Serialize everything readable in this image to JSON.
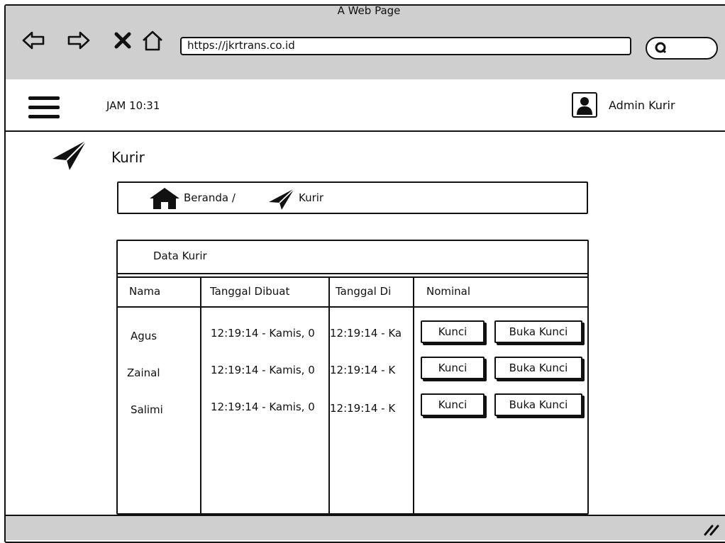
{
  "browser": {
    "title": "A Web Page",
    "url": "https://jkrtrans.co.id"
  },
  "header": {
    "time": "JAM 10:31",
    "user": "Admin Kurir"
  },
  "page": {
    "title": "Kurir",
    "breadcrumb": [
      "Beranda /",
      "Kurir"
    ]
  },
  "panel": {
    "title": "Data Kurir",
    "columns": [
      "Nama",
      "Tanggal Dibuat",
      "Tanggal Di",
      "Nominal"
    ],
    "rows": [
      {
        "nama": "Agus",
        "dibuat": "12:19:14 - Kamis, 0",
        "di": "12:19:14 - Ka"
      },
      {
        "nama": "Zainal",
        "dibuat": "12:19:14 - Kamis, 0",
        "di": "12:19:14 - K"
      },
      {
        "nama": "Salimi",
        "dibuat": "12:19:14 - Kamis, 0",
        "di": "12:19:14 - K"
      }
    ],
    "lock_label": "Kunci",
    "unlock_label": "Buka Kunci"
  },
  "icons": [
    "back-icon",
    "forward-icon",
    "close-icon",
    "home-icon",
    "search-icon",
    "menu-icon",
    "user-icon",
    "paper-plane-icon",
    "resize-grip-icon"
  ]
}
